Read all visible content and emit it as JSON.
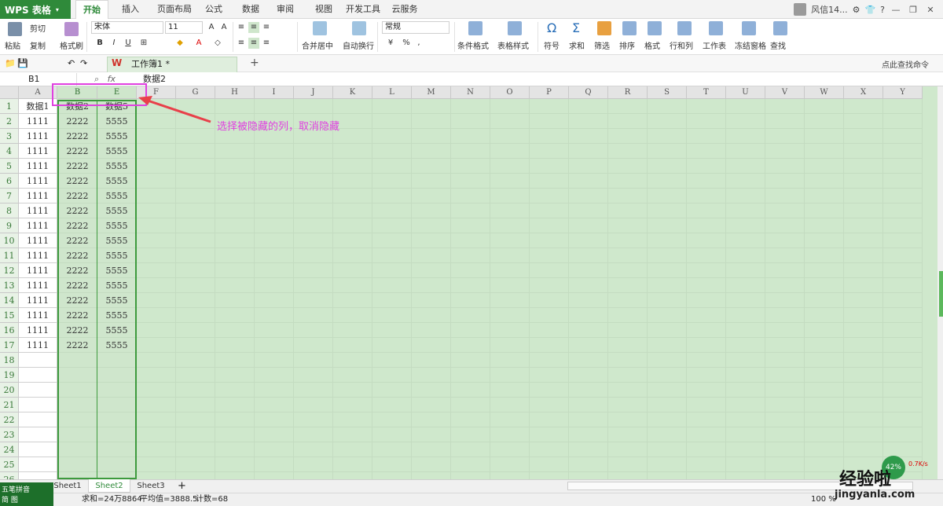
{
  "app": {
    "name": "WPS 表格",
    "dropdown": "▾"
  },
  "ribbon_tabs": [
    "开始",
    "插入",
    "页面布局",
    "公式",
    "数据",
    "审阅",
    "视图",
    "开发工具",
    "云服务"
  ],
  "user": {
    "name": "风信14..."
  },
  "ribbon": {
    "paste": "粘贴",
    "cut": "剪切",
    "copy": "复制",
    "format_painter": "格式刷",
    "font": "宋体",
    "font_size": "11",
    "merge_center": "合并居中",
    "wrap": "自动换行",
    "number_format": "常规",
    "cond_format": "条件格式",
    "table_style": "表格样式",
    "symbol": "符号",
    "sum": "求和",
    "filter": "筛选",
    "sort": "排序",
    "format": "格式",
    "row_col": "行和列",
    "worksheet": "工作表",
    "freeze": "冻结窗格",
    "find": "查找",
    "pct": "%",
    "comma": ",",
    "search_cmd": "点此查找命令"
  },
  "doc_tab": {
    "title": "工作簿1 *",
    "add": "+"
  },
  "formula": {
    "name_box": "B1",
    "fx": "fx",
    "value": "数据2"
  },
  "columns": [
    "A",
    "B",
    "E",
    "F",
    "G",
    "H",
    "I",
    "J",
    "K",
    "L",
    "M",
    "N",
    "O",
    "P",
    "Q",
    "R",
    "S",
    "T",
    "U",
    "V",
    "W",
    "X",
    "Y"
  ],
  "rows": [
    "1",
    "2",
    "3",
    "4",
    "5",
    "6",
    "7",
    "8",
    "9",
    "10",
    "11",
    "12",
    "13",
    "14",
    "15",
    "16",
    "17",
    "18",
    "19",
    "20",
    "21",
    "22",
    "23",
    "24",
    "25",
    "26"
  ],
  "cells": {
    "header": [
      "数据1",
      "数据2",
      "数据5"
    ],
    "data": [
      [
        "1111",
        "2222",
        "5555"
      ],
      [
        "1111",
        "2222",
        "5555"
      ],
      [
        "1111",
        "2222",
        "5555"
      ],
      [
        "1111",
        "2222",
        "5555"
      ],
      [
        "1111",
        "2222",
        "5555"
      ],
      [
        "1111",
        "2222",
        "5555"
      ],
      [
        "1111",
        "2222",
        "5555"
      ],
      [
        "1111",
        "2222",
        "5555"
      ],
      [
        "1111",
        "2222",
        "5555"
      ],
      [
        "1111",
        "2222",
        "5555"
      ],
      [
        "1111",
        "2222",
        "5555"
      ],
      [
        "1111",
        "2222",
        "5555"
      ],
      [
        "1111",
        "2222",
        "5555"
      ],
      [
        "1111",
        "2222",
        "5555"
      ],
      [
        "1111",
        "2222",
        "5555"
      ],
      [
        "1111",
        "2222",
        "5555"
      ]
    ]
  },
  "annotation": "选择被隐藏的列，取消隐藏",
  "sheets": [
    "Sheet1",
    "Sheet2",
    "Sheet3"
  ],
  "sheet_add": "+",
  "status": {
    "sum": "求和=24万8864",
    "avg": "平均值=3888.5",
    "count": "计数=68",
    "zoom": "100 %"
  },
  "ime": {
    "line1": "五笔拼音",
    "line2": "简 图"
  },
  "net": {
    "pct": "42%",
    "speed": "0.7K/s"
  },
  "watermark": {
    "line1": "经验啦",
    "line2": "jingyanla.com"
  },
  "colors": {
    "brand": "#2f8a3a",
    "selection": "#3d9a3d",
    "annotation": "#e040e0"
  }
}
